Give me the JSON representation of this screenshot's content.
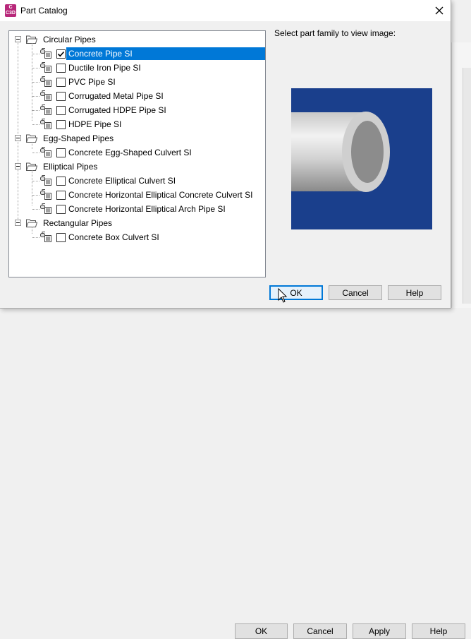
{
  "window": {
    "title": "Part Catalog",
    "app_icon_text": "C3D"
  },
  "prompt": "Select part family to view image:",
  "tree": {
    "groups": [
      {
        "label": "Circular Pipes",
        "items": [
          {
            "label": "Concrete Pipe SI",
            "checked": true,
            "selected": true
          },
          {
            "label": "Ductile Iron Pipe SI",
            "checked": false
          },
          {
            "label": "PVC Pipe SI",
            "checked": false
          },
          {
            "label": "Corrugated Metal Pipe SI",
            "checked": false
          },
          {
            "label": "Corrugated HDPE Pipe SI",
            "checked": false
          },
          {
            "label": "HDPE Pipe SI",
            "checked": false
          }
        ]
      },
      {
        "label": "Egg-Shaped Pipes",
        "items": [
          {
            "label": "Concrete Egg-Shaped Culvert SI",
            "checked": false
          }
        ]
      },
      {
        "label": "Elliptical Pipes",
        "items": [
          {
            "label": "Concrete Elliptical Culvert SI",
            "checked": false
          },
          {
            "label": "Concrete Horizontal Elliptical Concrete Culvert SI",
            "checked": false
          },
          {
            "label": "Concrete Horizontal Elliptical Arch Pipe SI",
            "checked": false
          }
        ]
      },
      {
        "label": "Rectangular Pipes",
        "items": [
          {
            "label": "Concrete Box Culvert SI",
            "checked": false
          }
        ]
      }
    ]
  },
  "buttons": {
    "ok": "OK",
    "cancel": "Cancel",
    "help": "Help"
  },
  "background_buttons": {
    "ok": "OK",
    "cancel": "Cancel",
    "apply": "Apply",
    "help": "Help"
  },
  "colors": {
    "selection": "#0078d7",
    "preview_bg": "#1a3f8c",
    "icon_accent": "#b8287a"
  }
}
